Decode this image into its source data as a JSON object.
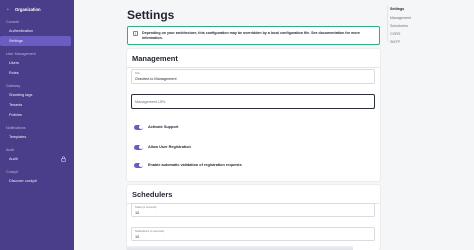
{
  "sidebar": {
    "org_label": "Organization",
    "sections": [
      {
        "title": "Console",
        "items": [
          {
            "label": "Authentication"
          },
          {
            "label": "Settings"
          }
        ]
      },
      {
        "title": "User Management",
        "items": [
          {
            "label": "Users"
          },
          {
            "label": "Roles"
          }
        ]
      },
      {
        "title": "Gateway",
        "items": [
          {
            "label": "Sharding tags"
          },
          {
            "label": "Tenants"
          },
          {
            "label": "Policies"
          }
        ]
      },
      {
        "title": "Notifications",
        "items": [
          {
            "label": "Templates"
          }
        ]
      },
      {
        "title": "Audit",
        "items": [
          {
            "label": "Audit"
          }
        ]
      },
      {
        "title": "Cockpit",
        "items": [
          {
            "label": "Discover cockpit"
          }
        ]
      }
    ],
    "active_item": "Settings",
    "colors": {
      "background": "#4a3e8a",
      "active": "#6a5cc0"
    }
  },
  "main": {
    "title": "Settings",
    "info_banner": "Depending on your architecture, this configuration may be overridden by a local configuration file. See documentation for more information.",
    "management": {
      "title": "Management",
      "title_field": {
        "label": "Title",
        "value": "Gravitee.io Management"
      },
      "url_field": {
        "placeholder": "Management URL"
      },
      "toggles": [
        {
          "label": "Activate Support",
          "on": true
        },
        {
          "label": "Allow User Registration",
          "on": true
        },
        {
          "label": "Enable automatic validation of registration requests",
          "on": true
        }
      ]
    },
    "schedulers": {
      "title": "Schedulers",
      "fields": [
        {
          "label": "Tasks (in seconds)",
          "value": "10"
        },
        {
          "label": "Notifications (in seconds)",
          "value": "10"
        }
      ]
    }
  },
  "toc": {
    "items": [
      "Settings",
      "Management",
      "Schedulers",
      "CORS",
      "SMTP"
    ],
    "active": "Settings"
  },
  "colors": {
    "accent": "#6a5cc0",
    "info_border": "#2fae85"
  }
}
